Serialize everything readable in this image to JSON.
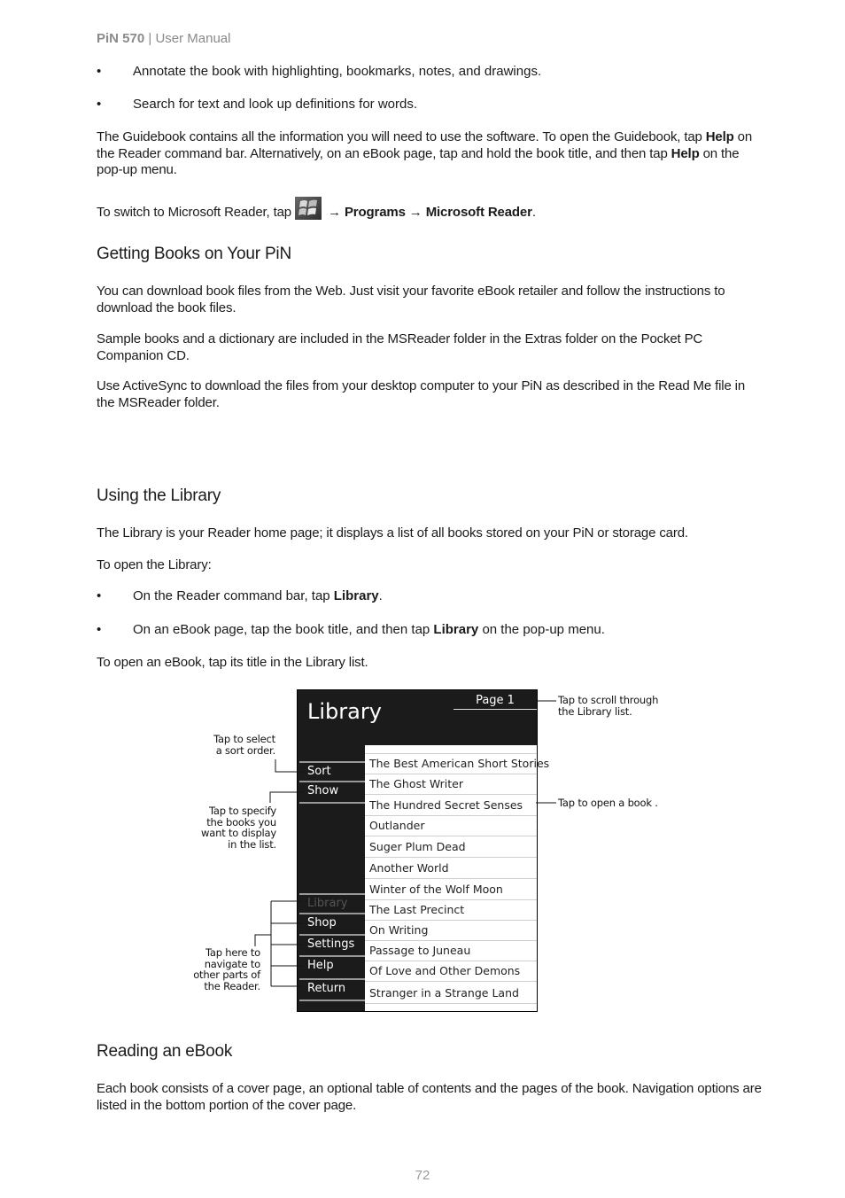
{
  "header": {
    "product": "PiN 570",
    "separator": " | ",
    "doc": "User Manual"
  },
  "intro_bullets": [
    "Annotate the book with highlighting, bookmarks, notes, and drawings.",
    "Search for text and look up definitions for words."
  ],
  "guidebook": {
    "part1": "The Guidebook contains all the information you will need to use the software. To open the Guidebook, tap ",
    "bold1": "Help",
    "part2": " on the Reader command bar. Alternatively, on an eBook page, tap and hold the book title, and then tap ",
    "bold2": "Help",
    "part3": " on the pop-up menu."
  },
  "switch": {
    "prefix": "To switch to Microsoft Reader, tap ",
    "icon": "windows-start-icon",
    "arrow": "→",
    "programs": "Programs",
    "reader": "Microsoft Reader",
    "suffix": "."
  },
  "section_getting": {
    "title": "Getting Books on Your PiN",
    "paragraphs": [
      "You can download book files from the Web. Just visit your favorite eBook retailer and follow the instructions to download the book files.",
      "Sample books and a dictionary are included in the MSReader folder in the Extras folder on the Pocket PC Companion CD.",
      "Use ActiveSync to download the files from your desktop computer to your PiN as described in the Read Me file in the MSReader folder."
    ]
  },
  "section_library": {
    "title": "Using the Library",
    "p1": "The Library is your Reader home page; it displays a list of all books stored on your PiN or storage card.",
    "p2": "To open the Library:",
    "bullet1": {
      "pre": "On the Reader command bar, tap ",
      "bold": "Library",
      "post": "."
    },
    "bullet2": {
      "pre": "On an eBook page, tap the book title, and then tap ",
      "bold": "Library",
      "post": " on the pop-up menu."
    },
    "p3": "To open an eBook, tap its title in the Library list."
  },
  "diagram": {
    "title": "Library",
    "page_label": "Page 1",
    "side_top": [
      "Sort",
      "Show"
    ],
    "side_bottom": [
      "Library",
      "Shop",
      "Settings",
      "Help",
      "Return"
    ],
    "books": [
      "The Best American Short Stories",
      "The Ghost Writer",
      "The Hundred Secret Senses",
      "Outlander",
      "Suger Plum Dead",
      "Another World",
      "Winter of the Wolf Moon",
      "The Last Precinct",
      "On Writing",
      "Passage to Juneau",
      "Of Love and Other Demons",
      "Stranger in a Strange Land"
    ],
    "callouts": {
      "sort": [
        "Tap to select",
        "a sort order."
      ],
      "show": [
        "Tap to specify",
        "the books you",
        "want to display",
        "in the list."
      ],
      "navigate": [
        "Tap here to",
        "navigate to",
        "other parts of",
        "the Reader."
      ],
      "scroll": [
        "Tap to scroll through",
        "the Library list."
      ],
      "open": [
        "Tap to open a book ."
      ]
    }
  },
  "section_reading": {
    "title": "Reading an eBook",
    "p1": "Each book consists of a cover page, an optional table of contents and the pages of the book. Navigation options are listed in the bottom portion of the cover page."
  },
  "footer": {
    "page_number": "72"
  }
}
